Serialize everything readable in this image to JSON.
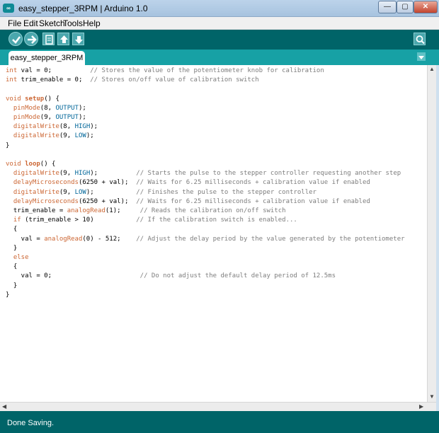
{
  "window": {
    "title": "easy_stepper_3RPM | Arduino 1.0",
    "app_icon_label": "∞",
    "minimize": "—",
    "maximize": "▢",
    "close": "✕"
  },
  "menu": {
    "items": [
      "File",
      "Edit",
      "Sketch",
      "Tools",
      "Help"
    ]
  },
  "toolbar": {
    "buttons": [
      "verify-icon",
      "upload-icon",
      "new-icon",
      "open-icon",
      "save-icon",
      "serial-monitor-icon"
    ]
  },
  "tabs": {
    "active": "easy_stepper_3RPM",
    "menu_icon": "triangle-down-icon"
  },
  "code": {
    "lines": [
      [
        {
          "t": "int",
          "c": "kw"
        },
        {
          "t": " val = 0;          "
        },
        {
          "t": "// Stores the value of the potentiometer knob for calibration",
          "c": "cm"
        }
      ],
      [
        {
          "t": "int",
          "c": "kw"
        },
        {
          "t": " trim_enable = 0;  "
        },
        {
          "t": "// Stores on/off value of calibration switch",
          "c": "cm"
        }
      ],
      [],
      [
        {
          "t": "void",
          "c": "kw"
        },
        {
          "t": " "
        },
        {
          "t": "setup",
          "c": "fn bold"
        },
        {
          "t": "() {"
        }
      ],
      [
        {
          "t": "  "
        },
        {
          "t": "pinMode",
          "c": "fn"
        },
        {
          "t": "(8, "
        },
        {
          "t": "OUTPUT",
          "c": "ct"
        },
        {
          "t": ");"
        }
      ],
      [
        {
          "t": "  "
        },
        {
          "t": "pinMode",
          "c": "fn"
        },
        {
          "t": "(9, "
        },
        {
          "t": "OUTPUT",
          "c": "ct"
        },
        {
          "t": ");"
        }
      ],
      [
        {
          "t": "  "
        },
        {
          "t": "digitalWrite",
          "c": "fn"
        },
        {
          "t": "(8, "
        },
        {
          "t": "HIGH",
          "c": "ct"
        },
        {
          "t": ");"
        }
      ],
      [
        {
          "t": "  "
        },
        {
          "t": "digitalWrite",
          "c": "fn"
        },
        {
          "t": "(9, "
        },
        {
          "t": "LOW",
          "c": "ct"
        },
        {
          "t": ");"
        }
      ],
      [
        {
          "t": "}"
        }
      ],
      [],
      [
        {
          "t": "void",
          "c": "kw"
        },
        {
          "t": " "
        },
        {
          "t": "loop",
          "c": "fn bold"
        },
        {
          "t": "() {"
        }
      ],
      [
        {
          "t": "  "
        },
        {
          "t": "digitalWrite",
          "c": "fn"
        },
        {
          "t": "(9, "
        },
        {
          "t": "HIGH",
          "c": "ct"
        },
        {
          "t": ");          "
        },
        {
          "t": "// Starts the pulse to the stepper controller requesting another step",
          "c": "cm"
        }
      ],
      [
        {
          "t": "  "
        },
        {
          "t": "delayMicroseconds",
          "c": "fn"
        },
        {
          "t": "(6250 + val);  "
        },
        {
          "t": "// Waits for 6.25 milliseconds + calibration value if enabled",
          "c": "cm"
        }
      ],
      [
        {
          "t": "  "
        },
        {
          "t": "digitalWrite",
          "c": "fn"
        },
        {
          "t": "(9, "
        },
        {
          "t": "LOW",
          "c": "ct"
        },
        {
          "t": ");           "
        },
        {
          "t": "// Finishes the pulse to the stepper controller",
          "c": "cm"
        }
      ],
      [
        {
          "t": "  "
        },
        {
          "t": "delayMicroseconds",
          "c": "fn"
        },
        {
          "t": "(6250 + val);  "
        },
        {
          "t": "// Waits for 6.25 milliseconds + calibration value if enabled",
          "c": "cm"
        }
      ],
      [
        {
          "t": "  trim_enable = "
        },
        {
          "t": "analogRead",
          "c": "fn"
        },
        {
          "t": "(1);     "
        },
        {
          "t": "// Reads the calibration on/off switch",
          "c": "cm"
        }
      ],
      [
        {
          "t": "  "
        },
        {
          "t": "if",
          "c": "kw"
        },
        {
          "t": " (trim_enable > 10)           "
        },
        {
          "t": "// If the calibration switch is enabled...",
          "c": "cm"
        }
      ],
      [
        {
          "t": "  {"
        }
      ],
      [
        {
          "t": "    val = "
        },
        {
          "t": "analogRead",
          "c": "fn"
        },
        {
          "t": "(0) - 512;    "
        },
        {
          "t": "// Adjust the delay period by the value generated by the potentiometer",
          "c": "cm"
        }
      ],
      [
        {
          "t": "  }"
        }
      ],
      [
        {
          "t": "  "
        },
        {
          "t": "else",
          "c": "kw"
        }
      ],
      [
        {
          "t": "  {"
        }
      ],
      [
        {
          "t": "    val = 0;                       "
        },
        {
          "t": "// Do not adjust the default delay period of 12.5ms",
          "c": "cm"
        }
      ],
      [
        {
          "t": "  }"
        }
      ],
      [
        {
          "t": "}"
        }
      ]
    ]
  },
  "scroll": {
    "up_icon": "arrow-up-icon",
    "down_icon": "arrow-down-icon",
    "left_icon": "arrow-left-icon",
    "right_icon": "arrow-right-icon"
  },
  "status": {
    "text": "Done Saving."
  },
  "colors": {
    "toolbar": "#006468",
    "tabs": "#17a1a5",
    "keyword": "#cc6633",
    "constant": "#006699",
    "comment": "#7e7e7e"
  }
}
